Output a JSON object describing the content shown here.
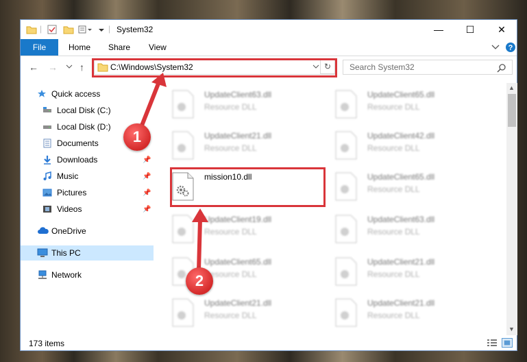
{
  "window": {
    "title": "System32",
    "controls": {
      "minimize": "—",
      "maximize": "☐",
      "close": "✕"
    }
  },
  "ribbon": {
    "tabs": [
      "File",
      "Home",
      "Share",
      "View"
    ]
  },
  "address": {
    "path": "C:\\Windows\\System32",
    "search_placeholder": "Search System32"
  },
  "sidebar": {
    "items": [
      {
        "label": "Quick access",
        "icon": "star-icon",
        "pinned": false
      },
      {
        "label": "Local Disk (C:)",
        "icon": "drive-icon",
        "pinned": false
      },
      {
        "label": "Local Disk (D:)",
        "icon": "drive-icon",
        "pinned": false
      },
      {
        "label": "Documents",
        "icon": "documents-icon",
        "pinned": false
      },
      {
        "label": "Downloads",
        "icon": "download-icon",
        "pinned": true
      },
      {
        "label": "Music",
        "icon": "music-icon",
        "pinned": true
      },
      {
        "label": "Pictures",
        "icon": "pictures-icon",
        "pinned": true
      },
      {
        "label": "Videos",
        "icon": "videos-icon",
        "pinned": true
      },
      {
        "label": "OneDrive",
        "icon": "cloud-icon",
        "pinned": false
      },
      {
        "label": "This PC",
        "icon": "computer-icon",
        "pinned": false,
        "selected": true
      },
      {
        "label": "Network",
        "icon": "network-icon",
        "pinned": false
      }
    ]
  },
  "files": [
    {
      "name": "UpdateClient63.dll",
      "type": "Resource DLL",
      "blurred": true
    },
    {
      "name": "UpdateClient65.dll",
      "type": "Resource DLL",
      "blurred": true
    },
    {
      "name": "UpdateClient21.dll",
      "type": "Resource DLL",
      "blurred": true
    },
    {
      "name": "UpdateClient42.dll",
      "type": "Resource DLL",
      "blurred": true
    },
    {
      "name": "mission10.dll",
      "type": "",
      "blurred": false
    },
    {
      "name": "UpdateClient65.dll",
      "type": "Resource DLL",
      "blurred": true
    },
    {
      "name": "UpdateClient19.dll",
      "type": "Resource DLL",
      "blurred": true
    },
    {
      "name": "UpdateClient63.dll",
      "type": "Resource DLL",
      "blurred": true
    },
    {
      "name": "UpdateClient65.dll",
      "type": "Resource DLL",
      "blurred": true
    },
    {
      "name": "UpdateClient21.dll",
      "type": "Resource DLL",
      "blurred": true
    },
    {
      "name": "UpdateClient21.dll",
      "type": "Resource DLL",
      "blurred": true
    },
    {
      "name": "UpdateClient21.dll",
      "type": "Resource DLL",
      "blurred": true
    }
  ],
  "status": {
    "item_count": "173 items"
  },
  "annotations": {
    "marker1": "1",
    "marker2": "2",
    "color": "#d9353a"
  },
  "colors": {
    "accent": "#1979ca",
    "selection": "#cce8ff"
  }
}
